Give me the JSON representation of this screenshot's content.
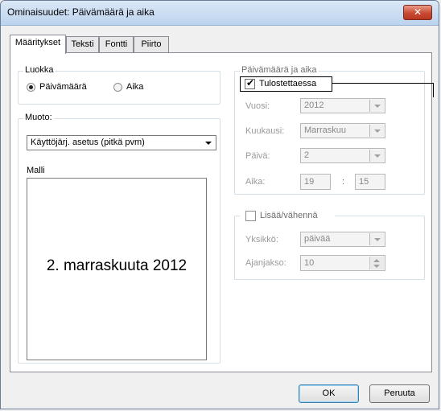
{
  "window": {
    "title": "Ominaisuudet: Päivämäärä ja aika",
    "close_glyph": "✕"
  },
  "tabs": [
    {
      "label": "Määritykset",
      "active": true
    },
    {
      "label": "Teksti",
      "active": false
    },
    {
      "label": "Fontti",
      "active": false
    },
    {
      "label": "Piirto",
      "active": false
    }
  ],
  "luokka": {
    "legend": "Luokka",
    "options": [
      {
        "label": "Päivämäärä",
        "selected": true
      },
      {
        "label": "Aika",
        "selected": false
      }
    ]
  },
  "muoto": {
    "legend": "Muoto:",
    "selected": "Käyttöjärj. asetus (pitkä pvm)",
    "malli_label": "Malli",
    "preview": "2. marraskuuta 2012"
  },
  "datetime": {
    "legend": "Päivämäärä ja aika",
    "print_label": "Tulostettaessa",
    "print_checked": true,
    "vuosi_label": "Vuosi:",
    "vuosi_value": "2012",
    "kuukausi_label": "Kuukausi:",
    "kuukausi_value": "Marraskuu",
    "paiva_label": "Päivä:",
    "paiva_value": "2",
    "aika_label": "Aika:",
    "hour": "19",
    "separator": ":",
    "minute": "15"
  },
  "adjust": {
    "label": "Lisää/vähennä",
    "checked": false,
    "yksikko_label": "Yksikkö:",
    "yksikko_value": "päivää",
    "ajanjakso_label": "Ajanjakso:",
    "ajanjakso_value": "10"
  },
  "buttons": {
    "ok": "OK",
    "cancel": "Peruuta"
  },
  "colors": {
    "close_button": "#c94a32",
    "titlebar": "#dbe8f6"
  }
}
